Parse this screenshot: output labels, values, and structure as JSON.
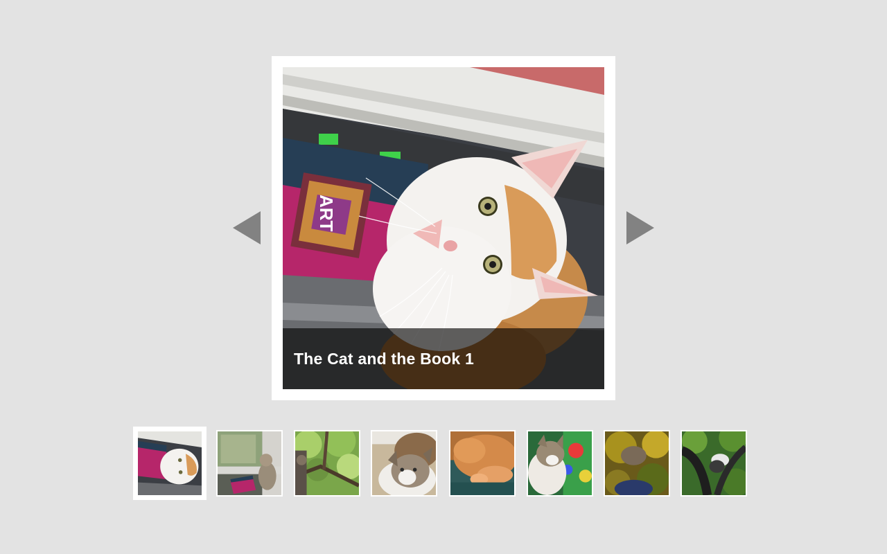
{
  "slider": {
    "caption": "The Cat and the Book 1",
    "active_index": 0,
    "slide_count": 8
  },
  "navigation": {
    "prev_icon": "triangle-left-icon",
    "next_icon": "triangle-right-icon",
    "arrow_color": "#828282"
  },
  "thumbnails": [
    {
      "subject": "white cat with book",
      "active": true
    },
    {
      "subject": "cat at window with book",
      "active": false
    },
    {
      "subject": "cat in tree",
      "active": false
    },
    {
      "subject": "tabby kitten",
      "active": false
    },
    {
      "subject": "sleeping orange cat",
      "active": false
    },
    {
      "subject": "kitten on colorful fabric",
      "active": false
    },
    {
      "subject": "cat in leaves",
      "active": false
    },
    {
      "subject": "cat in dark tree",
      "active": false
    }
  ],
  "colors": {
    "background": "#e3e3e3",
    "frame": "#ffffff",
    "caption_overlay": "rgba(0,0,0,0.62)",
    "caption_text": "#ffffff"
  }
}
